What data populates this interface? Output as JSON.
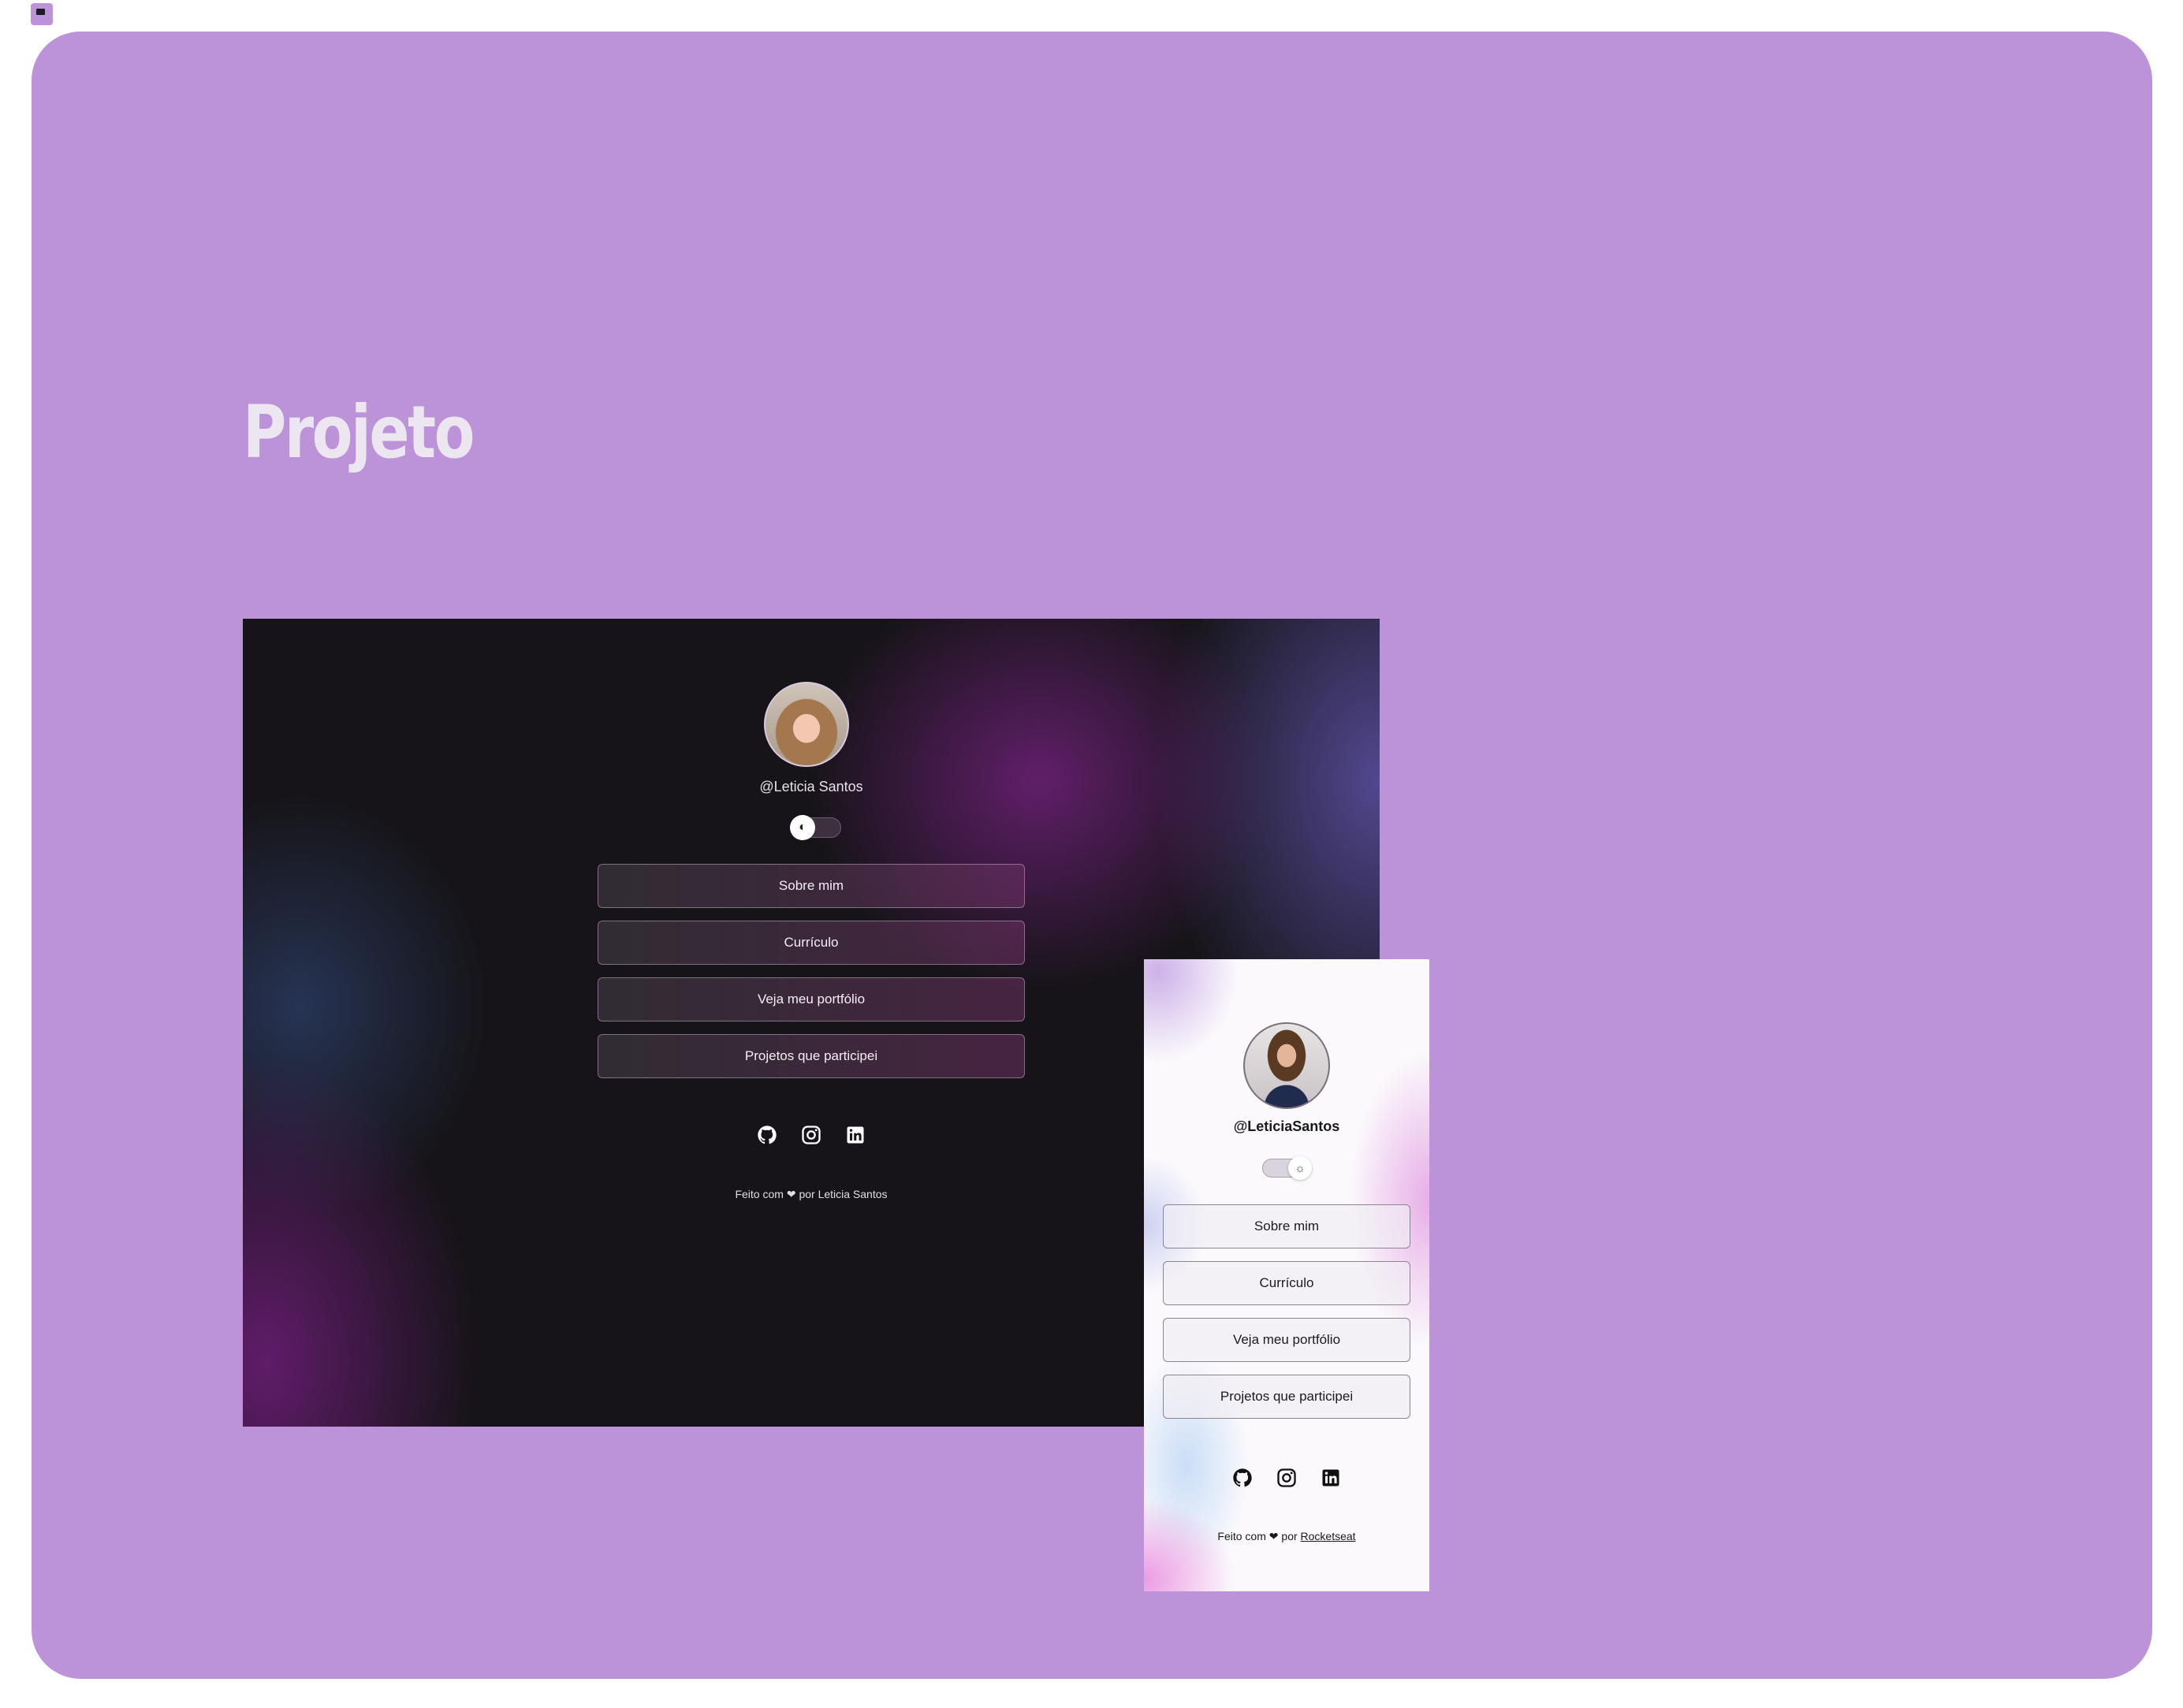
{
  "page": {
    "title": "Projeto",
    "background_color": "#bc93d9",
    "favicon_icon": "flag-icon"
  },
  "desktop_preview": {
    "theme": "dark",
    "avatar_icon": "profile-photo",
    "handle": "@Leticia Santos",
    "theme_toggle_icon": "moon-icon",
    "links": [
      {
        "label": "Sobre mim"
      },
      {
        "label": "Currículo"
      },
      {
        "label": "Veja meu portfólio"
      },
      {
        "label": "Projetos que participei"
      }
    ],
    "social": [
      {
        "icon": "github-icon"
      },
      {
        "icon": "instagram-icon"
      },
      {
        "icon": "linkedin-icon"
      }
    ],
    "footer": {
      "prefix": "Feito com",
      "heart_icon": "heart-icon",
      "middle": "por",
      "author": "Leticia Santos"
    }
  },
  "mobile_preview": {
    "theme": "light",
    "avatar_icon": "profile-photo",
    "handle": "@LeticiaSantos",
    "theme_toggle_icon": "sun-icon",
    "links": [
      {
        "label": "Sobre mim"
      },
      {
        "label": "Currículo"
      },
      {
        "label": "Veja meu portfólio"
      },
      {
        "label": "Projetos que participei"
      }
    ],
    "social": [
      {
        "icon": "github-icon"
      },
      {
        "icon": "instagram-icon"
      },
      {
        "icon": "linkedin-icon"
      }
    ],
    "footer": {
      "prefix": "Feito com",
      "heart_icon": "heart-icon",
      "middle": "por",
      "author": "Rocketseat"
    }
  }
}
